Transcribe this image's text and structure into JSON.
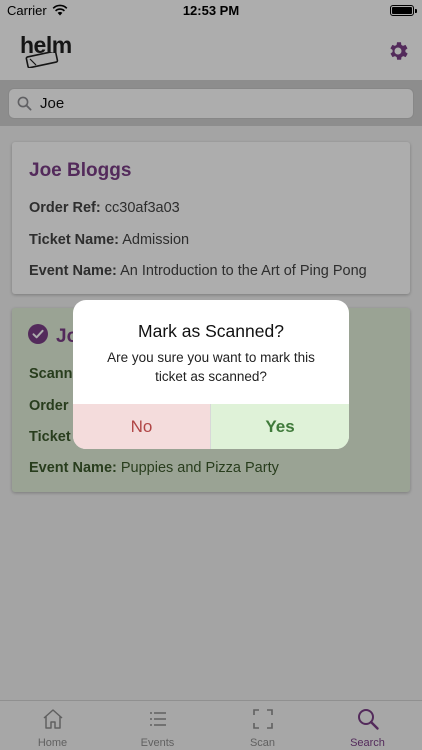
{
  "status_bar": {
    "carrier": "Carrier",
    "time": "12:53 PM"
  },
  "header": {
    "logo_text": "helm",
    "settings_icon": "gear-icon"
  },
  "search": {
    "value": "Joe"
  },
  "results": [
    {
      "name": "Joe Bloggs",
      "scanned": false,
      "rows": [
        {
          "label": "Order Ref:",
          "value": "cc30af3a03"
        },
        {
          "label": "Ticket Name:",
          "value": "Admission"
        },
        {
          "label": "Event Name:",
          "value": "An Introduction to the Art of Ping Pong"
        }
      ]
    },
    {
      "name": "Jo",
      "scanned": true,
      "rows": [
        {
          "label": "Scanne",
          "value": ""
        },
        {
          "label": "Order",
          "value": ""
        },
        {
          "label": "Ticket",
          "value": ""
        },
        {
          "label": "Event Name:",
          "value": "Puppies and Pizza Party"
        }
      ]
    }
  ],
  "dialog": {
    "title": "Mark as Scanned?",
    "message": "Are you sure you want to mark this ticket as scanned?",
    "no_label": "No",
    "yes_label": "Yes"
  },
  "tabs": [
    {
      "label": "Home",
      "icon": "home-icon",
      "active": false
    },
    {
      "label": "Events",
      "icon": "list-icon",
      "active": false
    },
    {
      "label": "Scan",
      "icon": "scan-icon",
      "active": false
    },
    {
      "label": "Search",
      "icon": "search-icon",
      "active": true
    }
  ],
  "colors": {
    "accent": "#7b3f87",
    "scanned_bg": "#e4f1db",
    "no_bg": "#f4dcdc",
    "yes_bg": "#dff2d8"
  }
}
